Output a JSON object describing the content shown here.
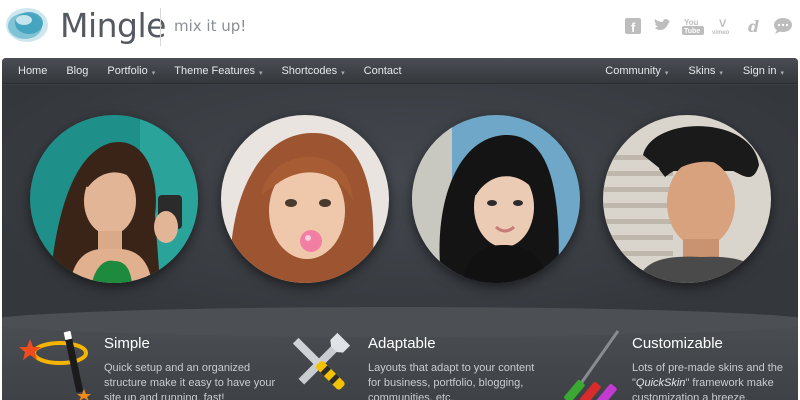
{
  "brand": {
    "name": "Mingle",
    "tagline": "mix it up!"
  },
  "social_icons": [
    "facebook-icon",
    "twitter-icon",
    "youtube-icon",
    "vimeo-icon",
    "delicious-icon",
    "chat-icon"
  ],
  "social_labels": {
    "facebook": "f",
    "youtube_top": "You",
    "youtube_bottom": "Tube",
    "vimeo_top": "V",
    "vimeo_bottom": "vimeo",
    "delicious": "d"
  },
  "nav": {
    "left": [
      {
        "label": "Home",
        "dropdown": false
      },
      {
        "label": "Blog",
        "dropdown": false
      },
      {
        "label": "Portfolio",
        "dropdown": true
      },
      {
        "label": "Theme Features",
        "dropdown": true
      },
      {
        "label": "Shortcodes",
        "dropdown": true
      },
      {
        "label": "Contact",
        "dropdown": false
      }
    ],
    "right": [
      {
        "label": "Community",
        "dropdown": true
      },
      {
        "label": "Skins",
        "dropdown": true
      },
      {
        "label": "Sign in",
        "dropdown": true
      }
    ],
    "caret": "▾"
  },
  "features": [
    {
      "title": "Simple",
      "text": "Quick setup and an organized structure make it easy to have your site up and running, fast!",
      "icon": "magic-wand-icon"
    },
    {
      "title": "Adaptable",
      "text": "Layouts that adapt to your content for business, portfolio, blogging, communities, etc.",
      "icon": "tools-icon"
    },
    {
      "title": "Customizable",
      "text_before": "Lots of pre-made skins and the \"",
      "text_em": "QuickSkin",
      "text_after": "\" framework make customization a breeze.",
      "icon": "paint-brushes-icon"
    }
  ],
  "colors": {
    "background": "#ffffff",
    "stage": "#3b3f44",
    "nav_text": "#e6e8ea",
    "logo_text": "#555a61",
    "logo_accent": "#5fb6c9"
  }
}
